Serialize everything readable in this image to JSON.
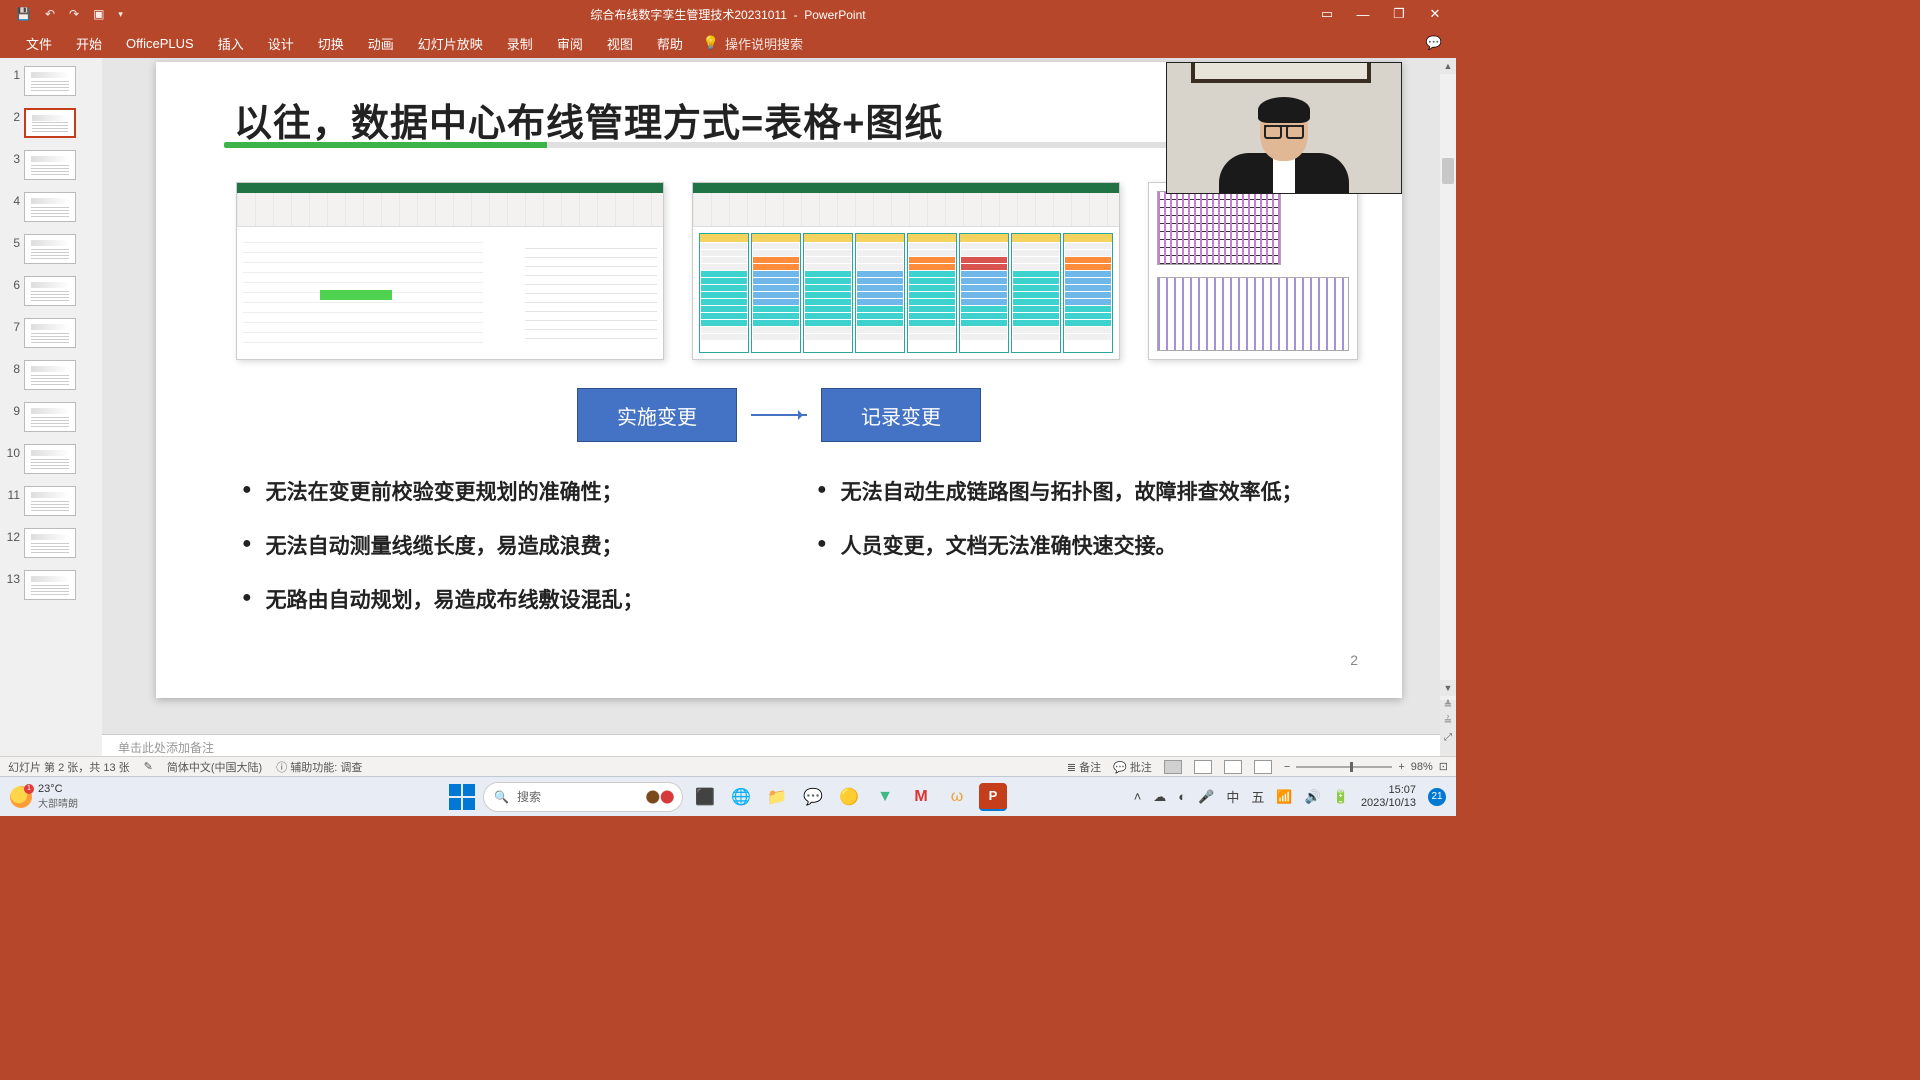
{
  "titlebar": {
    "doc_title": "综合布线数字孪生管理技术20231011",
    "app_name": "PowerPoint"
  },
  "ribbon": {
    "tabs": [
      "文件",
      "开始",
      "OfficePLUS",
      "插入",
      "设计",
      "切换",
      "动画",
      "幻灯片放映",
      "录制",
      "审阅",
      "视图",
      "帮助"
    ],
    "tell_me": "操作说明搜索"
  },
  "thumbs": {
    "count": 13,
    "selected": 2
  },
  "slide": {
    "title": "以往，数据中心布线管理方式=表格+图纸",
    "flow_left": "实施变更",
    "flow_right": "记录变更",
    "bullets_left": [
      "无法在变更前校验变更规划的准确性；",
      "无法自动测量线缆长度，易造成浪费；",
      "无路由自动规划，易造成布线敷设混乱；"
    ],
    "bullets_right": [
      "无法自动生成链路图与拓扑图，故障排查效率低；",
      "人员变更，文档无法准确快速交接。"
    ],
    "page_number": "2"
  },
  "notes": {
    "placeholder": "单击此处添加备注"
  },
  "status": {
    "slide_info": "幻灯片 第 2 张，共 13 张",
    "lang": "简体中文(中国大陆)",
    "access": "辅助功能: 调查",
    "notes_btn": "备注",
    "comments_btn": "批注",
    "zoom": "98%"
  },
  "taskbar": {
    "temp": "23°C",
    "weather": "大部晴朗",
    "weather_badge": "1",
    "search_placeholder": "搜索",
    "ime": "中",
    "ime2": "五",
    "time": "15:07",
    "date": "2023/10/13",
    "notif_count": "21"
  }
}
